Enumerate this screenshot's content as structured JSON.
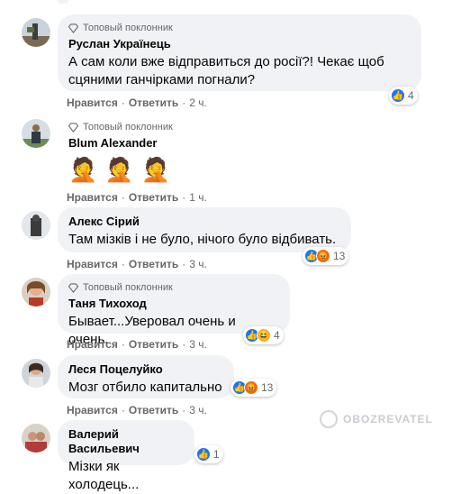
{
  "comments": [
    {
      "badge": "Топовый поклонник",
      "name": "Руслан Українець",
      "text": "А сам коли вже відправиться до росії?! Чекає щоб сцяними ганчірками погнали?",
      "like": "Нравится",
      "reply": "Ответить",
      "time": "2 ч.",
      "reactions_count": "4"
    },
    {
      "badge": "Топовый поклонник",
      "name": "Blum Alexander",
      "emojis": [
        "🤦",
        "🤦",
        "🤦"
      ],
      "like": "Нравится",
      "reply": "Ответить",
      "time": "1 ч."
    },
    {
      "name": "Алекс Сірий",
      "text": "Там мізків і не було, нічого було відбивать.",
      "like": "Нравится",
      "reply": "Ответить",
      "time": "3 ч.",
      "reactions_count": "13"
    },
    {
      "badge": "Топовый поклонник",
      "name": "Таня Тихоход",
      "text": "Бывает...Уверовал очень и очень.",
      "like": "Нравится",
      "reply": "Ответить",
      "time": "3 ч.",
      "reactions_count": "4"
    },
    {
      "name": "Леся Поцелуйко",
      "text": "Мозг отбило капитально",
      "like": "Нравится",
      "reply": "Ответить",
      "time": "3 ч.",
      "reactions_count": "13"
    },
    {
      "name": "Валерий Васильевич",
      "text": "Мізки як холодець...",
      "reactions_count": "1"
    }
  ],
  "watermark": "OBOZREVATEL",
  "colors": {
    "bubble": "#f0f2f5",
    "meta": "#65676b",
    "like": "#1877f2",
    "angry": "#e9710f",
    "haha": "#f7b125"
  },
  "icons": {
    "badge": "diamond-icon",
    "like": "like-reaction-icon",
    "angry": "angry-reaction-icon",
    "haha": "haha-reaction-icon"
  }
}
